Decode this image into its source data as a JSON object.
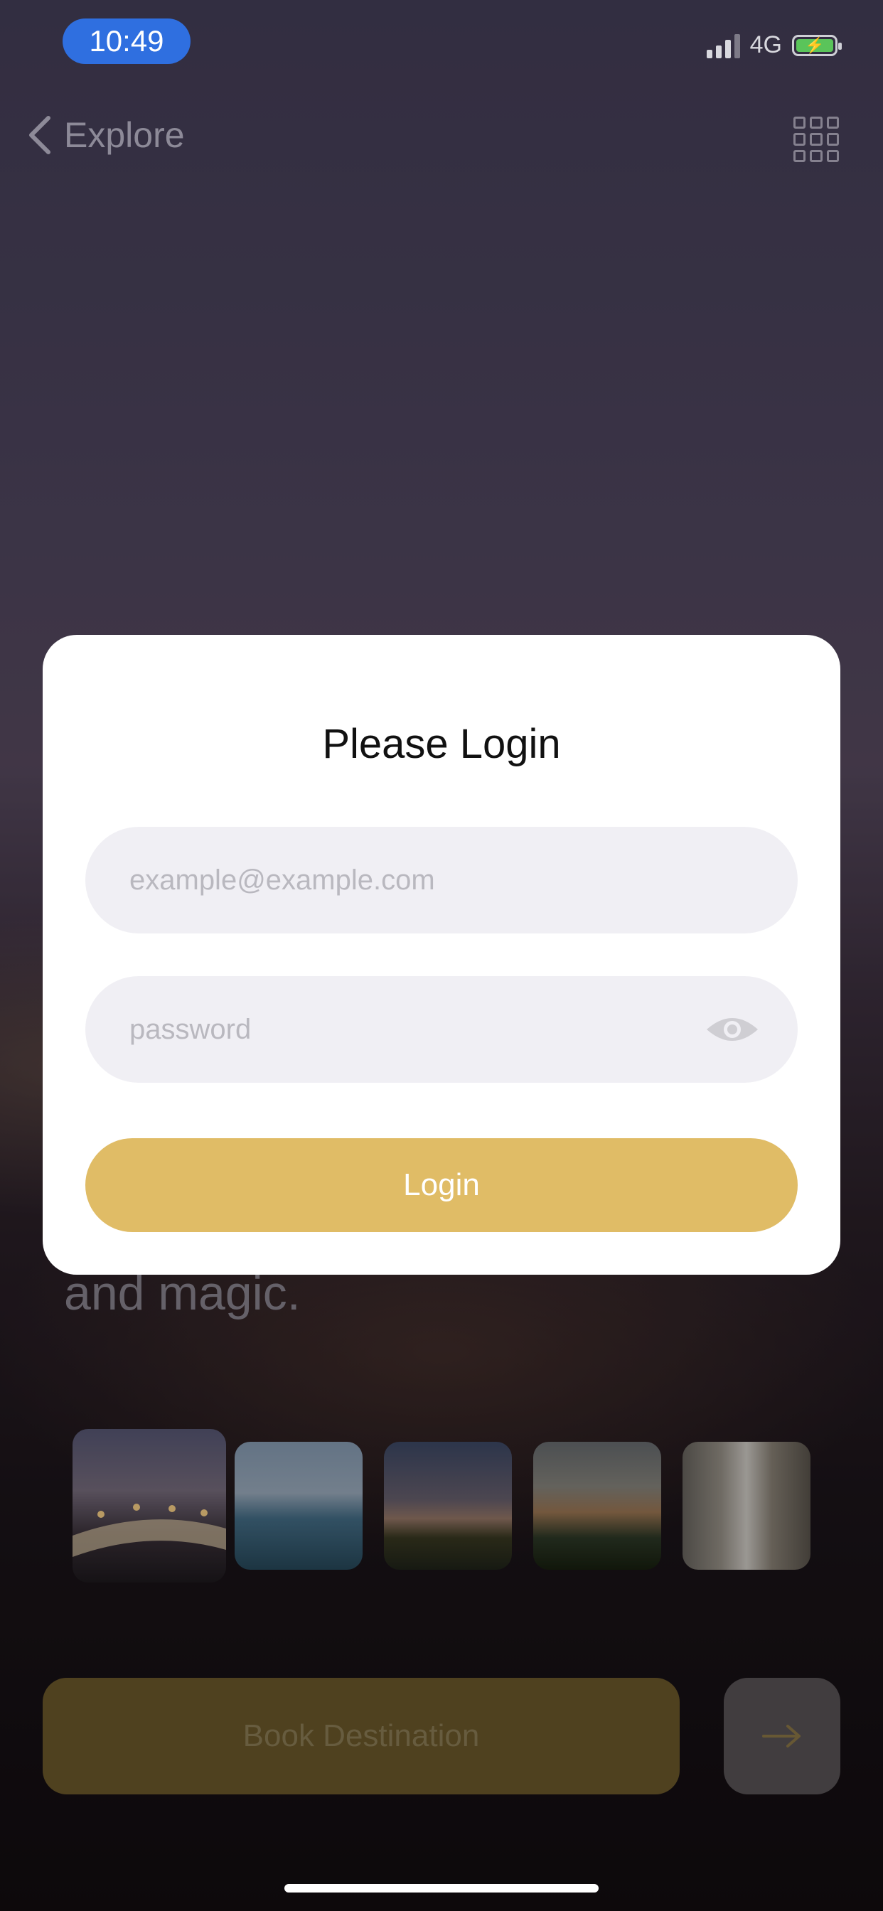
{
  "status_bar": {
    "time": "10:49",
    "network": "4G"
  },
  "nav": {
    "back_label": "Explore",
    "back_icon": "chevron-left-icon",
    "menu_icon": "grid-icon"
  },
  "modal": {
    "title": "Please Login",
    "email_placeholder": "example@example.com",
    "password_placeholder": "password",
    "login_label": "Login"
  },
  "background": {
    "headline_fragment": "and magic.",
    "book_label": "Book Destination",
    "thumbnails": [
      "bridge-night",
      "venice-lagoon",
      "dusk-hill",
      "mountain-forest",
      "city-street"
    ]
  },
  "colors": {
    "accent": "#E0BC66",
    "time_pill": "#2F6FE0",
    "battery": "#5AC45A"
  }
}
